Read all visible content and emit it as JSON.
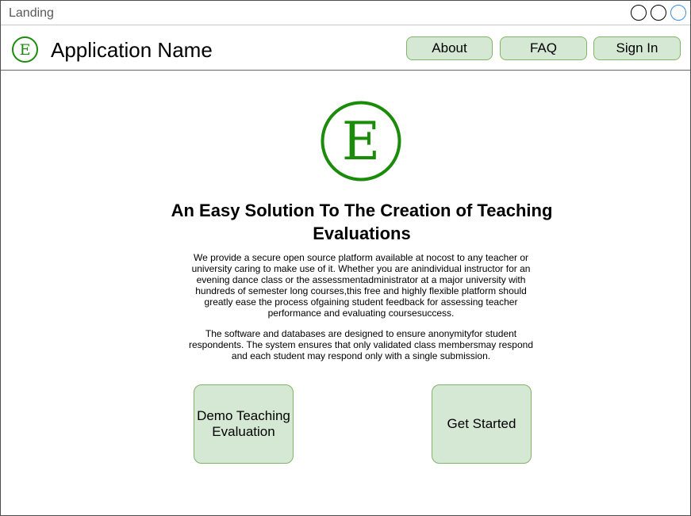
{
  "window": {
    "title": "Landing"
  },
  "header": {
    "app_name": "Application Name",
    "logo_letter": "E",
    "nav": [
      {
        "label": "About"
      },
      {
        "label": "FAQ"
      },
      {
        "label": "Sign In"
      }
    ]
  },
  "hero": {
    "logo_letter": "E",
    "headline": "An Easy Solution To The Creation of Teaching Evaluations",
    "paragraph1": "We provide a secure open source platform available at nocost to any teacher or university caring to make use of it. Whether you are anindividual instructor for an evening dance class or the assessmentadministrator at a major university with hundreds of semester long courses,this free and highly flexible platform should greatly ease the process ofgaining student feedback for assessing teacher performance and evaluating coursesuccess.",
    "paragraph2": "The software and databases are designed to ensure anonymityfor student respondents. The system ensures that only validated class membersmay respond and each student may respond only with a single submission.",
    "demo_button": "Demo Teaching Evaluation",
    "start_button": "Get Started"
  },
  "colors": {
    "accent_green": "#1a8c0a",
    "button_fill": "#d5e8d4",
    "button_border": "#82b366",
    "window_control_active": "#3c8fe0"
  },
  "icons": {
    "logo": "e-logo-icon",
    "window_controls": [
      "window-control-icon",
      "window-control-icon",
      "window-control-icon"
    ]
  }
}
